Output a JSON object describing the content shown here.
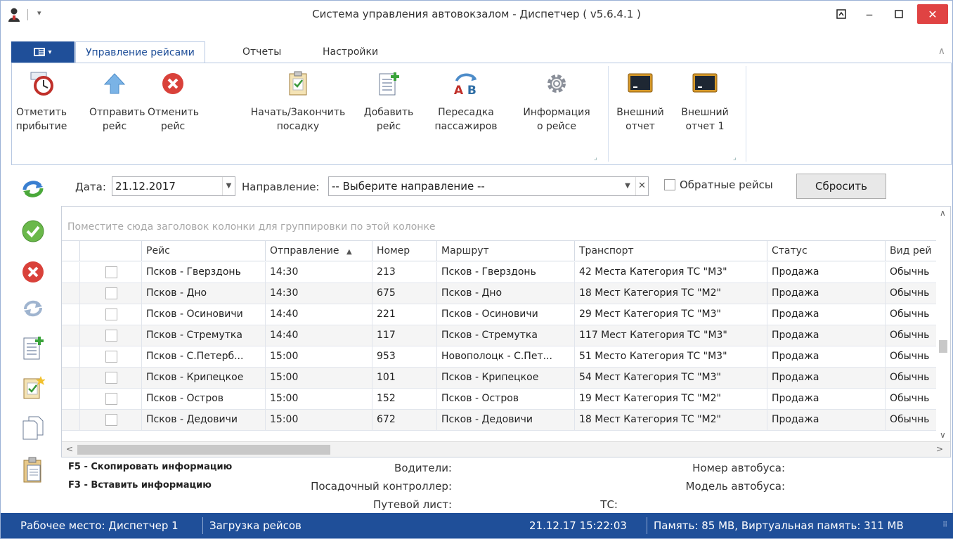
{
  "window": {
    "title": "Система управления автовокзалом - Диспетчер ( v5.6.4.1 )"
  },
  "ribbon_tabs": [
    "Управление рейсами",
    "Отчеты",
    "Настройки"
  ],
  "ribbon": {
    "buttons": [
      {
        "line1": "Отметить",
        "line2": "прибытие",
        "icon": "clock-arrival-icon"
      },
      {
        "line1": "Отправить",
        "line2": "рейс",
        "icon": "arrow-up-icon"
      },
      {
        "line1": "Отменить",
        "line2": "рейс",
        "icon": "cancel-circle-icon"
      },
      {
        "line1": "Начать/Закончить",
        "line2": "посадку",
        "icon": "clipboard-check-icon"
      },
      {
        "line1": "Добавить",
        "line2": "рейс",
        "icon": "add-document-icon"
      },
      {
        "line1": "Пересадка",
        "line2": "пассажиров",
        "icon": "transfer-ab-icon"
      },
      {
        "line1": "Информация",
        "line2": "о рейсе",
        "icon": "gear-icon"
      },
      {
        "line1": "Внешний",
        "line2": "отчет",
        "icon": "monitor-icon"
      },
      {
        "line1": "Внешний",
        "line2": "отчет 1",
        "icon": "monitor-icon"
      }
    ]
  },
  "filter": {
    "date_label": "Дата:",
    "date_value": "21.12.2017",
    "direction_label": "Направление:",
    "direction_value": "-- Выберите направление --",
    "reverse_label": "Обратные рейсы",
    "reverse_checked": false,
    "reset_label": "Сбросить"
  },
  "sidebar": {
    "icons": [
      "refresh-arrows-icon",
      "check-circle-icon",
      "cancel-circle-icon",
      "refresh-outline-icon",
      "add-document-icon",
      "clipboard-star-icon",
      "copy-document-icon",
      "paste-clipboard-icon"
    ]
  },
  "grid": {
    "group_hint": "Поместите сюда заголовок колонки для группировки по этой колонке",
    "columns": [
      "Рейс",
      "Отправление",
      "Номер",
      "Маршрут",
      "Транспорт",
      "Статус",
      "Вид рей"
    ],
    "sort_indicator": "▲",
    "rows": [
      {
        "trip": "Псков - Гверздонь",
        "departure": "14:30",
        "number": "213",
        "route": "Псков - Гверздонь",
        "transport": "42 Места Категория ТС \"М3\"",
        "status": "Продажа",
        "kind": "Обычнь"
      },
      {
        "trip": "Псков - Дно",
        "departure": "14:30",
        "number": "675",
        "route": "Псков - Дно",
        "transport": "18 Мест Категория ТС \"М2\"",
        "status": "Продажа",
        "kind": "Обычнь"
      },
      {
        "trip": "Псков - Осиновичи",
        "departure": "14:40",
        "number": "221",
        "route": "Псков - Осиновичи",
        "transport": "29 Мест Категория ТС \"М3\"",
        "status": "Продажа",
        "kind": "Обычнь"
      },
      {
        "trip": "Псков - Стремутка",
        "departure": "14:40",
        "number": "117",
        "route": "Псков - Стремутка",
        "transport": "117 Мест Категория ТС \"М3\"",
        "status": "Продажа",
        "kind": "Обычнь"
      },
      {
        "trip": "Псков - С.Петерб...",
        "departure": "15:00",
        "number": "953",
        "route": "Новополоцк - С.Пет...",
        "transport": "51 Место Категория ТС \"М3\"",
        "status": "Продажа",
        "kind": "Обычнь"
      },
      {
        "trip": "Псков - Крипецкое",
        "departure": "15:00",
        "number": "101",
        "route": "Псков - Крипецкое",
        "transport": "54 Мест Категория ТС \"М3\"",
        "status": "Продажа",
        "kind": "Обычнь"
      },
      {
        "trip": "Псков - Остров",
        "departure": "15:00",
        "number": "152",
        "route": "Псков - Остров",
        "transport": "19 Мест Категория ТС \"М2\"",
        "status": "Продажа",
        "kind": "Обычнь"
      },
      {
        "trip": "Псков - Дедовичи",
        "departure": "15:00",
        "number": "672",
        "route": "Псков - Дедовичи",
        "transport": "18 Мест Категория ТС \"М2\"",
        "status": "Продажа",
        "kind": "Обычнь"
      }
    ]
  },
  "info": {
    "hotkey_copy": "F5 - Скопировать информацию",
    "hotkey_paste": "F3 - Вставить информацию",
    "drivers_label": "Водители:",
    "controller_label": "Посадочный контроллер:",
    "waybill_label": "Путевой лист:",
    "bus_number_label": "Номер автобуса:",
    "bus_model_label": "Модель автобуса:",
    "ts_label": "ТС:"
  },
  "statusbar": {
    "workplace": "Рабочее место: Диспетчер 1",
    "loading": "Загрузка рейсов",
    "datetime": "21.12.17 15:22:03",
    "memory": "Память: 85 MB, Виртуальная память: 311 MB"
  },
  "colors": {
    "accent": "#1f4f99",
    "close": "#e04343"
  }
}
